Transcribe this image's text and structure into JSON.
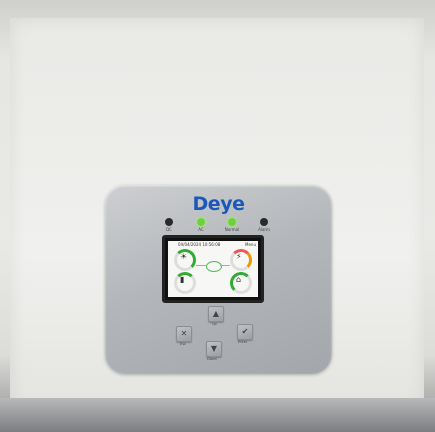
{
  "brand": {
    "logo_text": "Deye",
    "color": "#1c58b8"
  },
  "indicators": [
    {
      "label": "DC",
      "color": "#2a2a2a"
    },
    {
      "label": "AC",
      "color": "#6fd23a"
    },
    {
      "label": "Normal",
      "color": "#6fd23a"
    },
    {
      "label": "Alarm",
      "color": "#2a2a2a"
    }
  ],
  "display": {
    "datetime": "04/04/2024 10:56:08",
    "menu_label": "Menu",
    "gauges": [
      {
        "name": "pv",
        "icon": "solar-panel-icon",
        "value": ""
      },
      {
        "name": "grid",
        "icon": "grid-tower-icon",
        "value": ""
      },
      {
        "name": "battery",
        "icon": "battery-icon",
        "value": ""
      },
      {
        "name": "load",
        "icon": "home-icon",
        "value": ""
      }
    ]
  },
  "buttons": [
    {
      "name": "up",
      "label": "Up"
    },
    {
      "name": "esc",
      "label": "Esc"
    },
    {
      "name": "enter",
      "label": "Enter"
    },
    {
      "name": "down",
      "label": "Down"
    }
  ]
}
